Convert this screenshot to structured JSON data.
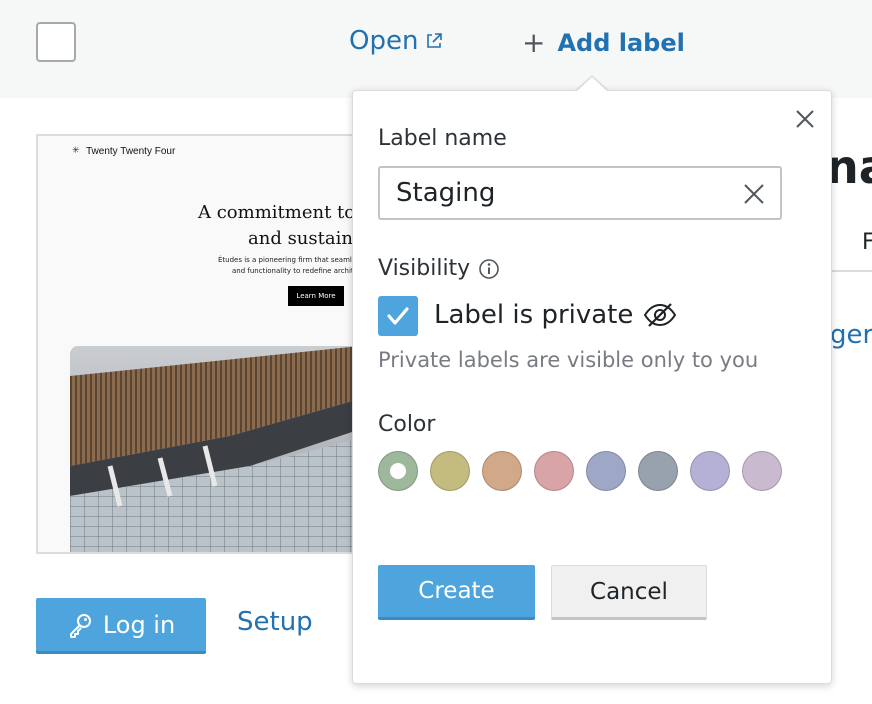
{
  "toolbar": {
    "open_label": "Open",
    "add_label": "Add label"
  },
  "preview": {
    "site_name": "Twenty Twenty Four",
    "headline_line1": "A commitment to i",
    "headline_line2": "and sustainab",
    "blurb_line1": "Études is a pioneering firm that seamlessl",
    "blurb_line2": "and functionality to redefine architect",
    "cta": "Learn More"
  },
  "actions": {
    "login_label": "Log in",
    "setup_label": "Setup"
  },
  "background_fragments": {
    "heading_fragment": "na",
    "tab_fragment": "F",
    "link_fragment": "ger"
  },
  "popover": {
    "name_label": "Label name",
    "name_value": "Staging",
    "visibility_label": "Visibility",
    "private_label": "Label is private",
    "private_checked": true,
    "private_help": "Private labels are visible only to you",
    "color_label": "Color",
    "colors": [
      "#9eb89c",
      "#c3bc7e",
      "#d1a888",
      "#d8a4a6",
      "#9ea8c6",
      "#98a1ae",
      "#b5b1d6",
      "#c9bad0"
    ],
    "selected_color_index": 0,
    "create_label": "Create",
    "cancel_label": "Cancel"
  }
}
